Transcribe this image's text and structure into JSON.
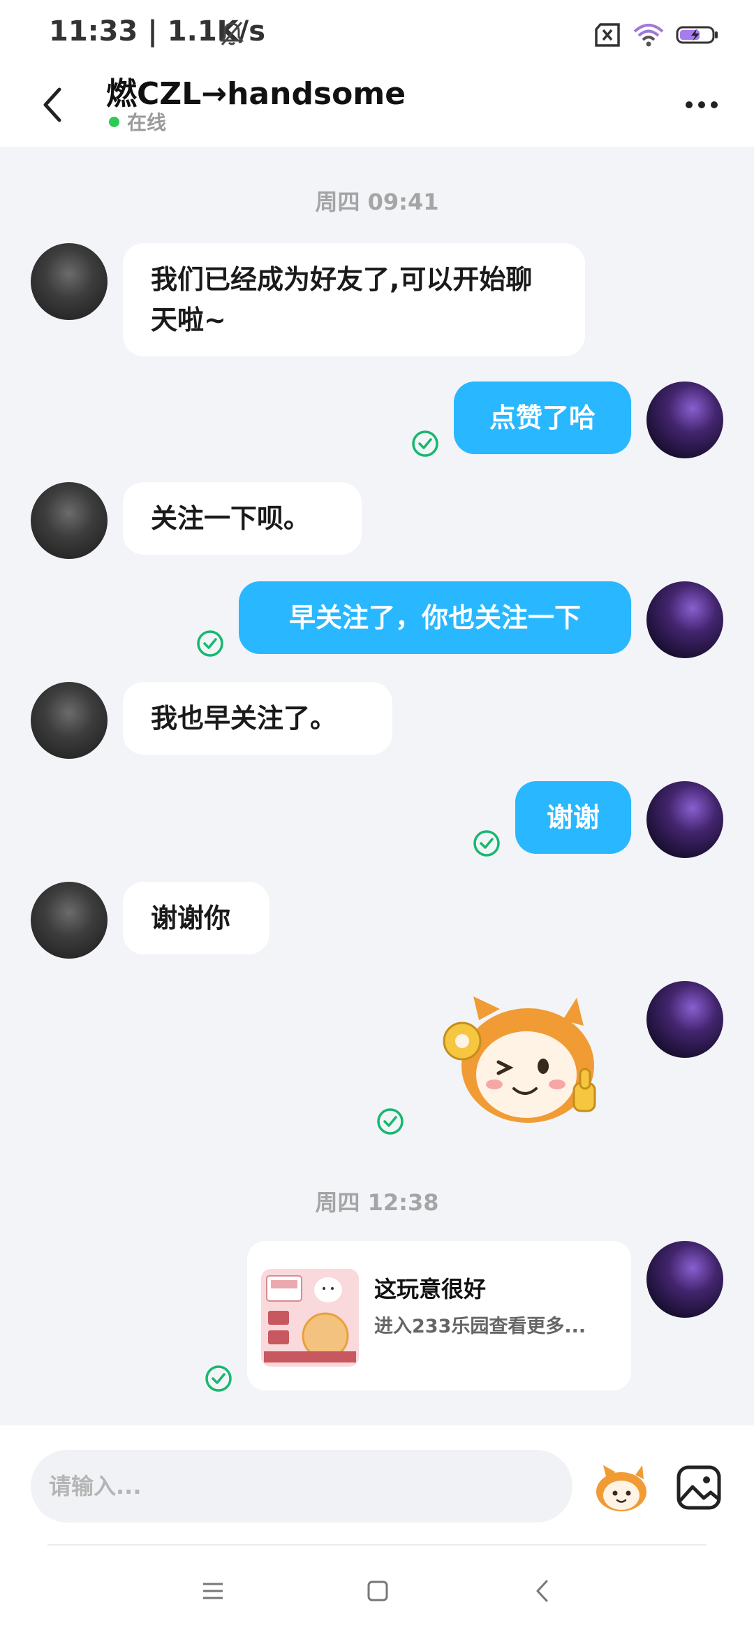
{
  "status_bar": {
    "time": "11:33 | 1.1K/s"
  },
  "header": {
    "title": "燃CZL→handsome",
    "status": "在线"
  },
  "chat": {
    "time_labels": [
      "周四 09:41",
      "周四 12:38"
    ],
    "messages": [
      {
        "from": "other",
        "text": "我们已经成为好友了,可以开始聊天啦~"
      },
      {
        "from": "me",
        "text": "点赞了哈"
      },
      {
        "from": "other",
        "text": "关注一下呗。"
      },
      {
        "from": "me",
        "text": "早关注了，你也关注一下"
      },
      {
        "from": "other",
        "text": "我也早关注了。"
      },
      {
        "from": "me",
        "text": "谢谢"
      },
      {
        "from": "other",
        "text": "谢谢你"
      },
      {
        "from": "me",
        "type": "sticker"
      },
      {
        "from": "me",
        "type": "card",
        "title": "这玩意很好",
        "subtitle": "进入233乐园查看更多..."
      }
    ]
  },
  "input": {
    "placeholder": "请输入..."
  },
  "colors": {
    "accent": "#29b7ff",
    "online": "#2ecb52",
    "check": "#16b86e"
  }
}
